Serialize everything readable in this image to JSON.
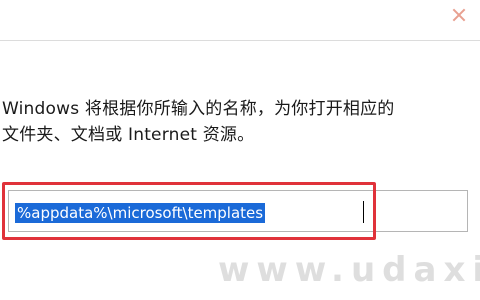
{
  "dialog": {
    "description_line1": "Windows 将根据你所输入的名称，为你打开相应的",
    "description_line2": "文件夹、文档或 Internet 资源。"
  },
  "open_input": {
    "value": "%appdata%\\microsoft\\templates",
    "selected": true
  },
  "watermark": "www.udaxia.com",
  "colors": {
    "selection": "#1b6ad8",
    "highlight_frame": "#e0323a",
    "close_icon": "#e8a090"
  },
  "icons": {
    "close": "close-icon"
  }
}
